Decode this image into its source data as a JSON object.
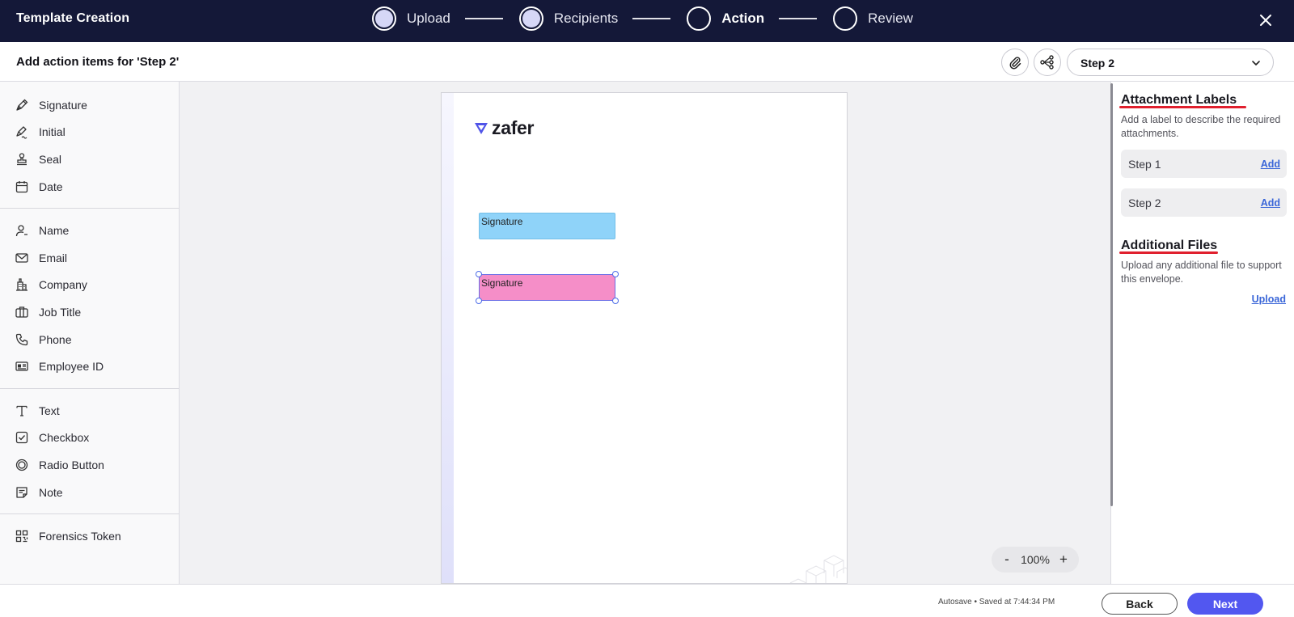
{
  "header": {
    "title": "Template Creation",
    "steps": [
      {
        "label": "Upload",
        "state": "done"
      },
      {
        "label": "Recipients",
        "state": "done"
      },
      {
        "label": "Action",
        "state": "active"
      },
      {
        "label": "Review",
        "state": "pending"
      }
    ],
    "close_icon": "close-icon"
  },
  "subheader": {
    "title": "Add action items for 'Step 2'",
    "attach_icon": "paperclip-icon",
    "workflow_icon": "workflow-icon",
    "step_select_value": "Step 2"
  },
  "tools": {
    "group1": [
      {
        "label": "Signature",
        "icon": "pen-nib-icon"
      },
      {
        "label": "Initial",
        "icon": "initial-pen-icon"
      },
      {
        "label": "Seal",
        "icon": "stamp-icon"
      },
      {
        "label": "Date",
        "icon": "calendar-icon"
      }
    ],
    "group2": [
      {
        "label": "Name",
        "icon": "user-icon"
      },
      {
        "label": "Email",
        "icon": "envelope-icon"
      },
      {
        "label": "Company",
        "icon": "building-icon"
      },
      {
        "label": "Job Title",
        "icon": "briefcase-icon"
      },
      {
        "label": "Phone",
        "icon": "phone-icon"
      },
      {
        "label": "Employee ID",
        "icon": "id-card-icon"
      }
    ],
    "group3": [
      {
        "label": "Text",
        "icon": "text-icon"
      },
      {
        "label": "Checkbox",
        "icon": "checkbox-icon"
      },
      {
        "label": "Radio Button",
        "icon": "radio-icon"
      },
      {
        "label": "Note",
        "icon": "note-icon"
      }
    ],
    "group4": [
      {
        "label": "Forensics Token",
        "icon": "qr-code-icon"
      }
    ]
  },
  "document": {
    "logo_text": "zafer",
    "fields": [
      {
        "label": "Signature",
        "color": "#8fd3f9"
      },
      {
        "label": "Signature",
        "color": "#f58ec8",
        "selected": true
      }
    ],
    "zoom": {
      "minus": "-",
      "value": "100%",
      "plus": "+"
    }
  },
  "right_panel": {
    "attachment_heading": "Attachment Labels",
    "attachment_desc": "Add a label to describe the required attachments.",
    "labels": [
      {
        "name": "Step 1",
        "action": "Add"
      },
      {
        "name": "Step 2",
        "action": "Add"
      }
    ],
    "files_heading": "Additional Files",
    "files_desc": "Upload any additional file to support this envelope.",
    "upload_label": "Upload"
  },
  "footer": {
    "autosave": "Autosave • Saved at 7:44:34 PM",
    "back_label": "Back",
    "next_label": "Next"
  },
  "colors": {
    "header_bg": "#141838",
    "accent": "#5257f0",
    "link": "#3a66d8",
    "underline": "#e0202e"
  }
}
